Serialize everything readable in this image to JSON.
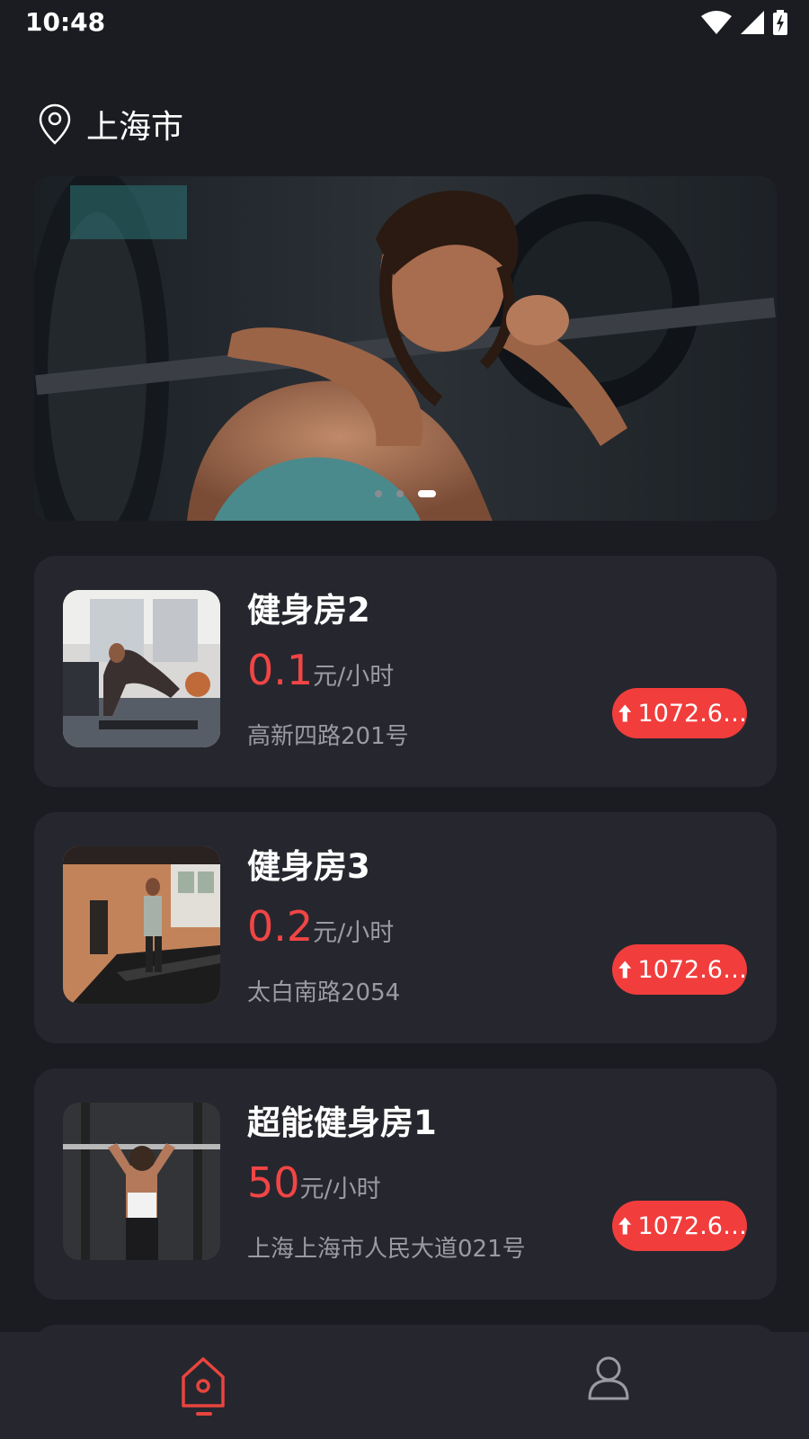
{
  "status_bar": {
    "time": "10:48",
    "icons": [
      "wifi-icon",
      "signal-icon",
      "battery-charging-icon"
    ]
  },
  "location": {
    "icon": "location-pin-icon",
    "city": "上海市"
  },
  "banner": {
    "page_count": 3,
    "active_index": 2
  },
  "venues": [
    {
      "name": "健身房2",
      "price": "0.1",
      "price_unit": "元/小时",
      "address": "高新四路201号",
      "distance": "1072.6…"
    },
    {
      "name": "健身房3",
      "price": "0.2",
      "price_unit": "元/小时",
      "address": "太白南路2054",
      "distance": "1072.6…"
    },
    {
      "name": "超能健身房1",
      "price": "50",
      "price_unit": "元/小时",
      "address": "上海上海市人民大道021号",
      "distance": "1072.6…"
    }
  ],
  "bottom_nav": {
    "items": [
      {
        "icon": "home-icon",
        "active": true
      },
      {
        "icon": "profile-icon",
        "active": false
      }
    ]
  },
  "colors": {
    "background": "#1b1c22",
    "card": "#26272e",
    "accent": "#f23d3d",
    "muted_text": "#9a9ba2"
  }
}
